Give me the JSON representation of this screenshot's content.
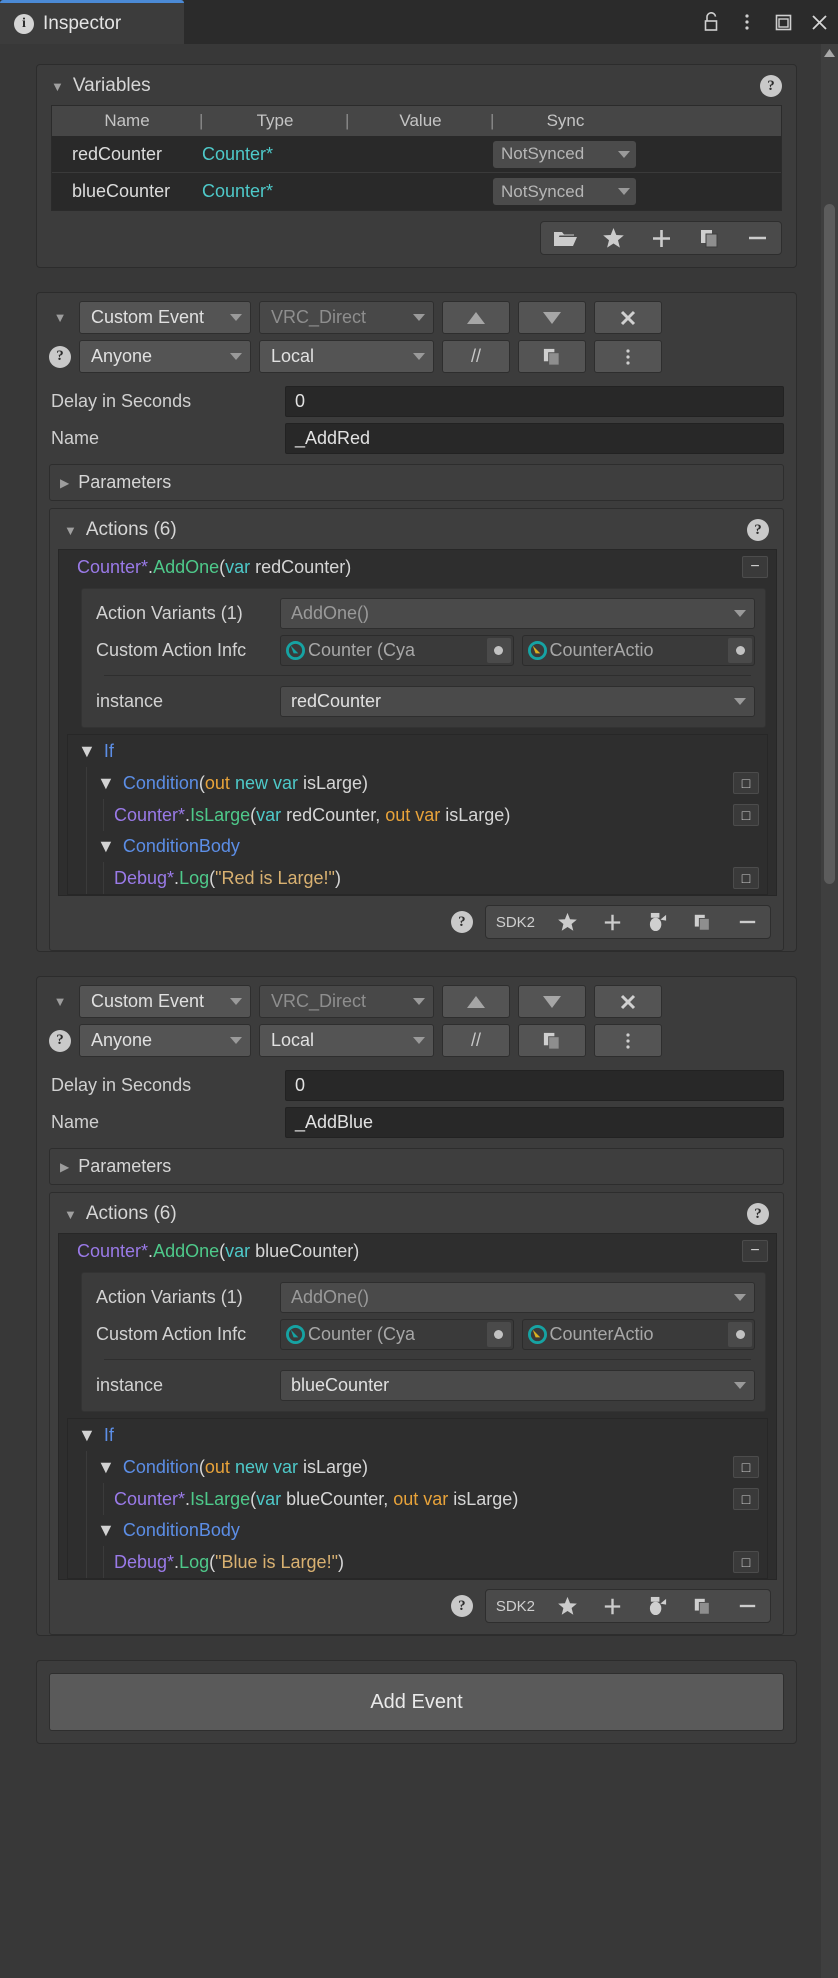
{
  "window": {
    "tab_title": "Inspector",
    "icons": {
      "info": "info-icon",
      "lock": "lock-icon",
      "menu": "kebab-menu-icon",
      "maximize": "maximize-icon",
      "close": "close-icon"
    }
  },
  "variables": {
    "section_title": "Variables",
    "help_label": "?",
    "columns": [
      "Name",
      "Type",
      "Value",
      "Sync"
    ],
    "rows": [
      {
        "name": "redCounter",
        "type": "Counter*",
        "value": "",
        "sync": "NotSynced"
      },
      {
        "name": "blueCounter",
        "type": "Counter*",
        "value": "",
        "sync": "NotSynced"
      }
    ],
    "toolbar": [
      "folder-icon",
      "star-icon",
      "plus-icon",
      "copy-icon",
      "minus-icon"
    ]
  },
  "events": [
    {
      "type_dropdown": "Custom Event",
      "network_dropdown": "VRC_Direct",
      "move_up": "▲",
      "move_down": "▼",
      "remove": "✖",
      "who_dropdown": "Anyone",
      "scope_dropdown": "Local",
      "comment_btn": "//",
      "copy_btn": "copy-icon",
      "more_btn": "kebab-menu-icon",
      "delay_label": "Delay in Seconds",
      "delay_value": "0",
      "name_label": "Name",
      "name_value": "_AddRed",
      "parameters_label": "Parameters",
      "actions_label": "Actions (6)",
      "action": {
        "signature": {
          "type": "Counter*",
          "dot": ".",
          "method": "AddOne",
          "open": "(",
          "var_kw": "var",
          "arg": "redCounter",
          "close": ")"
        },
        "collapse_glyph": "−",
        "variants_label": "Action Variants (1)",
        "variants_value": "AddOne()",
        "custom_info_label": "Custom Action Infc",
        "custom_info_obj1": "Counter (Cya",
        "custom_info_obj2": "CounterActio",
        "instance_label": "instance",
        "instance_value": "redCounter"
      },
      "if_label": "If",
      "condition": {
        "name": "Condition",
        "open": "(",
        "out_kw": "out",
        "new_var_kw": "new var",
        "arg": "isLarge",
        "close": ")"
      },
      "condition_call": {
        "type": "Counter*",
        "dot": ".",
        "method": "IsLarge",
        "open": "(",
        "var_kw": "var",
        "arg1": "redCounter",
        "comma": ", ",
        "out_kw": "out var",
        "arg2": "isLarge",
        "close": ")"
      },
      "condition_body_label": "ConditionBody",
      "body_call": {
        "type": "Debug*",
        "dot": ".",
        "method": "Log",
        "open": "(",
        "string": "\"Red is Large!\"",
        "close": ")"
      },
      "footer": {
        "help": "?",
        "sdk_label": "SDK2",
        "icons": [
          "star-icon",
          "plus-icon",
          "paste-icon",
          "copy-icon",
          "minus-icon"
        ]
      }
    },
    {
      "type_dropdown": "Custom Event",
      "network_dropdown": "VRC_Direct",
      "move_up": "▲",
      "move_down": "▼",
      "remove": "✖",
      "who_dropdown": "Anyone",
      "scope_dropdown": "Local",
      "comment_btn": "//",
      "copy_btn": "copy-icon",
      "more_btn": "kebab-menu-icon",
      "delay_label": "Delay in Seconds",
      "delay_value": "0",
      "name_label": "Name",
      "name_value": "_AddBlue",
      "parameters_label": "Parameters",
      "actions_label": "Actions (6)",
      "action": {
        "signature": {
          "type": "Counter*",
          "dot": ".",
          "method": "AddOne",
          "open": "(",
          "var_kw": "var",
          "arg": "blueCounter",
          "close": ")"
        },
        "collapse_glyph": "−",
        "variants_label": "Action Variants (1)",
        "variants_value": "AddOne()",
        "custom_info_label": "Custom Action Infc",
        "custom_info_obj1": "Counter (Cya",
        "custom_info_obj2": "CounterActio",
        "instance_label": "instance",
        "instance_value": "blueCounter"
      },
      "if_label": "If",
      "condition": {
        "name": "Condition",
        "open": "(",
        "out_kw": "out",
        "new_var_kw": "new var",
        "arg": "isLarge",
        "close": ")"
      },
      "condition_call": {
        "type": "Counter*",
        "dot": ".",
        "method": "IsLarge",
        "open": "(",
        "var_kw": "var",
        "arg1": "blueCounter",
        "comma": ", ",
        "out_kw": "out var",
        "arg2": "isLarge",
        "close": ")"
      },
      "condition_body_label": "ConditionBody",
      "body_call": {
        "type": "Debug*",
        "dot": ".",
        "method": "Log",
        "open": "(",
        "string": "\"Blue is Large!\"",
        "close": ")"
      },
      "footer": {
        "help": "?",
        "sdk_label": "SDK2",
        "icons": [
          "star-icon",
          "plus-icon",
          "paste-icon",
          "copy-icon",
          "minus-icon"
        ]
      }
    }
  ],
  "add_event_button": "Add Event",
  "colors": {
    "accent_tab": "#4b8ad6",
    "type_purple": "#9a7ae8",
    "method_green": "#4ec98a",
    "var_cyan": "#4ec9c9",
    "out_orange": "#e8a33a",
    "block_blue": "#5c8ee6",
    "string_tan": "#d9b171",
    "panel_bg": "#3c3c3c",
    "window_bg": "#383838"
  }
}
